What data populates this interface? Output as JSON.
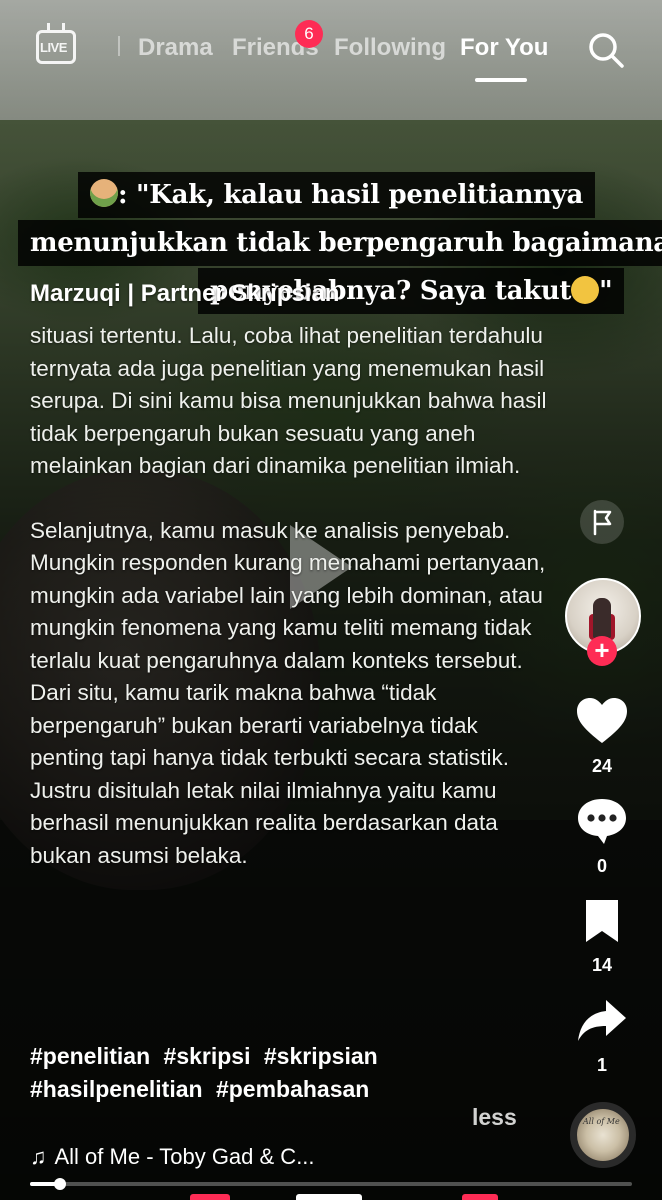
{
  "topbar": {
    "live_label": "LIVE",
    "tabs": [
      {
        "label": "Drama",
        "active": false
      },
      {
        "label": "Friends",
        "active": false,
        "badge": "6"
      },
      {
        "label": "Following",
        "active": false
      },
      {
        "label": "For You",
        "active": true
      }
    ],
    "search_icon": "search-icon"
  },
  "caption": {
    "line1": ": \"Kak, kalau hasil penelitiannya",
    "line2": "menunjukkan tidak berpengaruh bagaimana",
    "line3": "penyebabnya? Saya takut",
    "line3_end": "\""
  },
  "post": {
    "author": "Marzuqi | Partner Skripsian",
    "paragraph1": "situasi tertentu. Lalu, coba lihat penelitian terdahulu ternyata ada juga penelitian yang menemukan hasil serupa. Di sini kamu bisa menunjukkan bahwa hasil tidak berpengaruh bukan sesuatu yang aneh melainkan bagian dari dinamika penelitian ilmiah.",
    "paragraph2": "Selanjutnya, kamu masuk ke analisis penyebab. Mungkin responden kurang memahami pertanyaan, mungkin ada variabel lain yang lebih dominan, atau mungkin fenomena yang kamu teliti memang tidak terlalu kuat pengaruhnya dalam konteks tersebut. Dari situ, kamu tarik makna bahwa “tidak berpengaruh” bukan berarti variabelnya tidak penting tapi hanya tidak terbukti secara statistik. Justru disitulah letak nilai ilmiahnya yaitu kamu berhasil menunjukkan realita berdasarkan data bukan asumsi belaka.",
    "hashtags": [
      "#penelitian",
      "#skripsi",
      "#skripsian",
      "#hasilpenelitian",
      "#pembahasan"
    ],
    "less_label": "less",
    "music": "All of Me - Toby Gad & C...",
    "progress": 0.05
  },
  "rail": {
    "likes": "24",
    "comments": "0",
    "saves": "14",
    "shares": "1",
    "disc_text": "All of Me"
  },
  "colors": {
    "accent": "#fe2c55",
    "text": "#ffffff"
  }
}
